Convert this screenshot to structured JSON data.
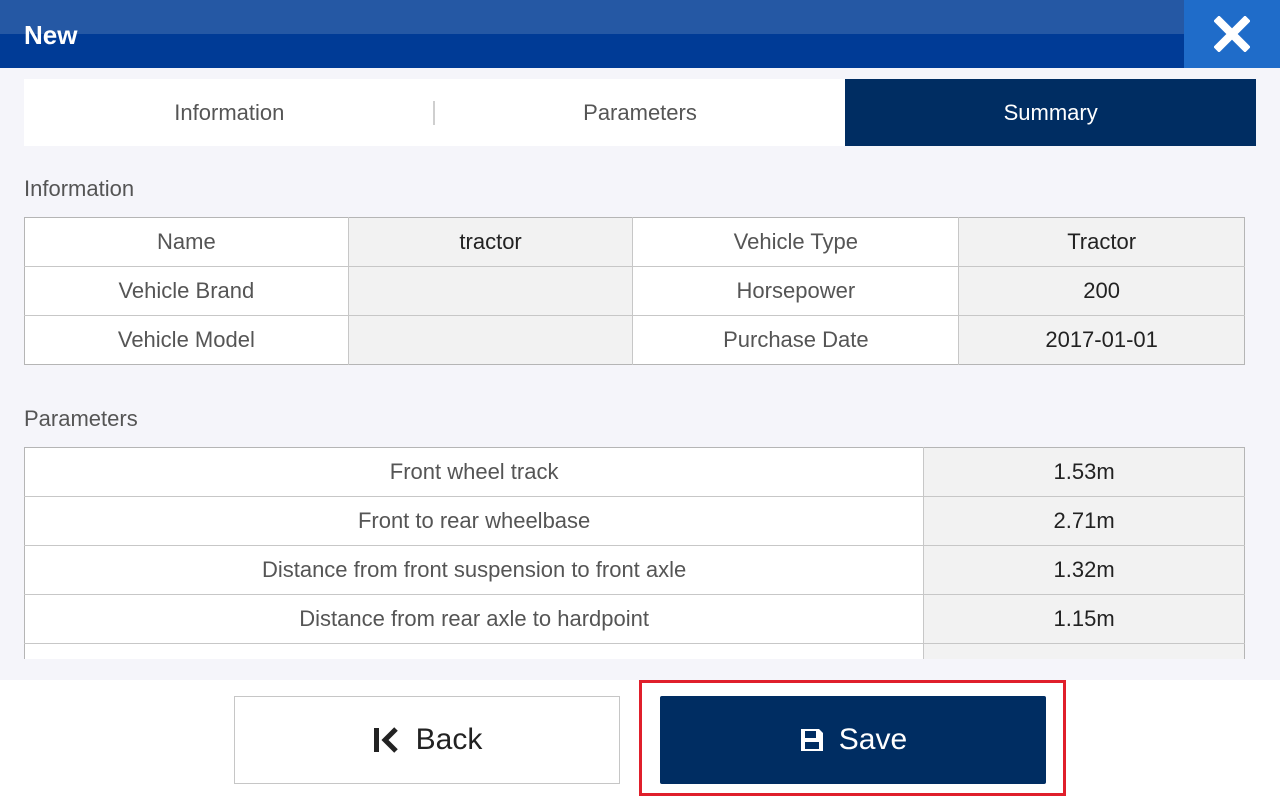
{
  "header": {
    "title": "New",
    "close_icon": "close-icon"
  },
  "tabs": [
    {
      "label": "Information",
      "active": false
    },
    {
      "label": "Parameters",
      "active": false
    },
    {
      "label": "Summary",
      "active": true
    }
  ],
  "information": {
    "heading": "Information",
    "rows": [
      {
        "label1": "Name",
        "value1": "tractor",
        "label2": "Vehicle Type",
        "value2": "Tractor"
      },
      {
        "label1": "Vehicle Brand",
        "value1": "",
        "label2": "Horsepower",
        "value2": "200"
      },
      {
        "label1": "Vehicle Model",
        "value1": "",
        "label2": "Purchase Date",
        "value2": "2017-01-01"
      }
    ]
  },
  "parameters": {
    "heading": "Parameters",
    "rows": [
      {
        "label": "Front wheel track",
        "value": "1.53m"
      },
      {
        "label": "Front to rear wheelbase",
        "value": "2.71m"
      },
      {
        "label": "Distance from front suspension to front axle",
        "value": "1.32m"
      },
      {
        "label": "Distance from rear axle to hardpoint",
        "value": "1.15m"
      },
      {
        "label": "",
        "value": ""
      }
    ]
  },
  "footer": {
    "back_label": "Back",
    "save_label": "Save"
  },
  "colors": {
    "header": "#003b96",
    "primary": "#002d62",
    "highlight": "#e01f2b"
  }
}
